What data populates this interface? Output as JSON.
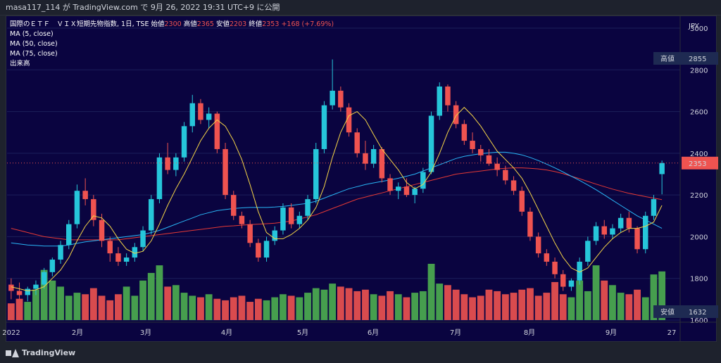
{
  "header": {
    "publisher": "masa117_114 が TradingView.com で 9月 26, 2022 19:31 UTC+9 に公開"
  },
  "footer": {
    "brand": "TradingView"
  },
  "legend": {
    "symbol": "国際のＥＴＦ　ＶＩＸ短期先物指数, 1日, TSE",
    "open_label": "始値",
    "open": "2300",
    "high_label": "高値",
    "high": "2365",
    "low_label": "安値",
    "low": "2203",
    "close_label": "終値",
    "close": "2353",
    "change": "+168 (+7.69%)",
    "ma5": "MA (5, close)",
    "ma50": "MA (50, close)",
    "ma75": "MA (75, close)",
    "volume": "出来高"
  },
  "colors": {
    "up": "#26c6da",
    "down": "#ef5350",
    "vol_up": "#4caf50",
    "vol_down": "#ef5350",
    "ma5": "#f5d547",
    "ma50": "#29b6f6",
    "ma75": "#e53935",
    "background": "#0a0440"
  },
  "chart_data": {
    "type": "candlestick",
    "currency": "JPY",
    "y_axis": {
      "ticks": [
        1600,
        1800,
        2000,
        2200,
        2400,
        2600,
        2800,
        3000
      ],
      "range": [
        1600,
        3000
      ]
    },
    "x_axis": {
      "ticks": [
        "2022",
        "2月",
        "3月",
        "4月",
        "5月",
        "6月",
        "7月",
        "8月",
        "9月",
        "27"
      ]
    },
    "markers": [
      {
        "label": "高値",
        "value": 2855
      },
      {
        "label": "安値",
        "value": 1632
      }
    ],
    "last_price": 2353,
    "candles": [
      [
        1770,
        1800,
        1700,
        1740
      ],
      [
        1740,
        1780,
        1700,
        1720
      ],
      [
        1720,
        1760,
        1690,
        1750
      ],
      [
        1750,
        1790,
        1720,
        1770
      ],
      [
        1770,
        1850,
        1750,
        1830
      ],
      [
        1830,
        1900,
        1810,
        1890
      ],
      [
        1890,
        1980,
        1870,
        1960
      ],
      [
        1960,
        2080,
        1940,
        2060
      ],
      [
        2060,
        2250,
        2040,
        2220
      ],
      [
        2220,
        2280,
        2150,
        2180
      ],
      [
        2180,
        2200,
        2050,
        2080
      ],
      [
        2080,
        2110,
        1950,
        1980
      ],
      [
        1980,
        2000,
        1880,
        1920
      ],
      [
        1920,
        1950,
        1860,
        1880
      ],
      [
        1880,
        1920,
        1860,
        1900
      ],
      [
        1900,
        1970,
        1880,
        1950
      ],
      [
        1950,
        2050,
        1930,
        2030
      ],
      [
        2030,
        2200,
        2010,
        2180
      ],
      [
        2180,
        2400,
        2160,
        2380
      ],
      [
        2380,
        2450,
        2300,
        2320
      ],
      [
        2320,
        2400,
        2290,
        2380
      ],
      [
        2380,
        2550,
        2360,
        2530
      ],
      [
        2530,
        2680,
        2500,
        2640
      ],
      [
        2640,
        2660,
        2540,
        2560
      ],
      [
        2560,
        2620,
        2520,
        2590
      ],
      [
        2590,
        2600,
        2400,
        2420
      ],
      [
        2420,
        2450,
        2180,
        2200
      ],
      [
        2200,
        2220,
        2080,
        2100
      ],
      [
        2100,
        2120,
        2040,
        2060
      ],
      [
        2060,
        2080,
        1950,
        1970
      ],
      [
        1970,
        1990,
        1880,
        1900
      ],
      [
        1900,
        2000,
        1880,
        1980
      ],
      [
        1980,
        2050,
        1960,
        2030
      ],
      [
        2030,
        2160,
        2010,
        2140
      ],
      [
        2140,
        2160,
        2040,
        2060
      ],
      [
        2060,
        2120,
        2040,
        2100
      ],
      [
        2100,
        2200,
        2080,
        2180
      ],
      [
        2180,
        2450,
        2160,
        2420
      ],
      [
        2420,
        2650,
        2400,
        2630
      ],
      [
        2630,
        2850,
        2610,
        2700
      ],
      [
        2700,
        2720,
        2600,
        2620
      ],
      [
        2620,
        2640,
        2480,
        2500
      ],
      [
        2500,
        2520,
        2380,
        2400
      ],
      [
        2400,
        2460,
        2320,
        2350
      ],
      [
        2350,
        2440,
        2330,
        2420
      ],
      [
        2420,
        2430,
        2260,
        2280
      ],
      [
        2280,
        2300,
        2200,
        2220
      ],
      [
        2220,
        2260,
        2180,
        2240
      ],
      [
        2240,
        2280,
        2190,
        2200
      ],
      [
        2200,
        2240,
        2160,
        2230
      ],
      [
        2230,
        2330,
        2210,
        2310
      ],
      [
        2310,
        2600,
        2300,
        2580
      ],
      [
        2580,
        2740,
        2560,
        2720
      ],
      [
        2720,
        2730,
        2600,
        2630
      ],
      [
        2630,
        2650,
        2520,
        2540
      ],
      [
        2540,
        2560,
        2440,
        2460
      ],
      [
        2460,
        2500,
        2400,
        2420
      ],
      [
        2420,
        2440,
        2360,
        2390
      ],
      [
        2390,
        2420,
        2340,
        2350
      ],
      [
        2350,
        2380,
        2290,
        2320
      ],
      [
        2320,
        2340,
        2250,
        2270
      ],
      [
        2270,
        2290,
        2200,
        2220
      ],
      [
        2220,
        2240,
        2100,
        2120
      ],
      [
        2120,
        2140,
        1980,
        2000
      ],
      [
        2000,
        2020,
        1900,
        1920
      ],
      [
        1920,
        1940,
        1860,
        1880
      ],
      [
        1880,
        1900,
        1800,
        1820
      ],
      [
        1820,
        1840,
        1740,
        1760
      ],
      [
        1760,
        1800,
        1740,
        1790
      ],
      [
        1790,
        1900,
        1770,
        1880
      ],
      [
        1880,
        2000,
        1860,
        1980
      ],
      [
        1980,
        2070,
        1960,
        2050
      ],
      [
        2050,
        2080,
        1990,
        2010
      ],
      [
        2010,
        2060,
        1990,
        2040
      ],
      [
        2040,
        2110,
        2020,
        2090
      ],
      [
        2090,
        2120,
        2020,
        2040
      ],
      [
        2040,
        2050,
        1920,
        1940
      ],
      [
        1940,
        2120,
        1920,
        2100
      ],
      [
        2100,
        2200,
        2080,
        2180
      ],
      [
        2300,
        2365,
        2203,
        2353
      ]
    ],
    "volume": [
      110,
      140,
      120,
      200,
      330,
      260,
      220,
      160,
      180,
      170,
      210,
      160,
      130,
      170,
      220,
      160,
      260,
      310,
      360,
      220,
      230,
      180,
      160,
      150,
      170,
      140,
      130,
      150,
      160,
      120,
      140,
      130,
      150,
      170,
      160,
      150,
      180,
      210,
      200,
      240,
      220,
      210,
      190,
      200,
      170,
      160,
      190,
      170,
      150,
      180,
      190,
      370,
      240,
      230,
      200,
      170,
      150,
      160,
      200,
      190,
      170,
      180,
      200,
      210,
      160,
      180,
      250,
      170,
      150,
      260,
      190,
      360,
      260,
      230,
      180,
      170,
      200,
      150,
      300,
      320
    ],
    "ma5": [
      1760,
      1750,
      1740,
      1745,
      1760,
      1800,
      1840,
      1900,
      1980,
      2050,
      2100,
      2090,
      2050,
      1990,
      1940,
      1920,
      1930,
      1980,
      2060,
      2150,
      2230,
      2300,
      2380,
      2460,
      2520,
      2560,
      2530,
      2460,
      2370,
      2250,
      2120,
      2020,
      1990,
      1990,
      2010,
      2040,
      2080,
      2140,
      2240,
      2380,
      2500,
      2580,
      2600,
      2560,
      2490,
      2420,
      2370,
      2320,
      2260,
      2230,
      2250,
      2310,
      2400,
      2500,
      2580,
      2620,
      2580,
      2530,
      2470,
      2410,
      2370,
      2330,
      2280,
      2210,
      2130,
      2050,
      1970,
      1900,
      1850,
      1830,
      1850,
      1900,
      1950,
      1990,
      2020,
      2040,
      2040,
      2050,
      2070,
      2150
    ],
    "ma50": [
      1970,
      1965,
      1960,
      1958,
      1955,
      1955,
      1955,
      1960,
      1968,
      1975,
      1980,
      1985,
      1990,
      1995,
      2000,
      2005,
      2010,
      2020,
      2030,
      2045,
      2060,
      2075,
      2090,
      2105,
      2115,
      2125,
      2130,
      2135,
      2138,
      2140,
      2140,
      2140,
      2142,
      2145,
      2150,
      2155,
      2160,
      2170,
      2185,
      2200,
      2215,
      2230,
      2240,
      2250,
      2258,
      2265,
      2272,
      2280,
      2290,
      2300,
      2315,
      2330,
      2345,
      2360,
      2375,
      2385,
      2392,
      2398,
      2402,
      2405,
      2405,
      2400,
      2392,
      2380,
      2365,
      2348,
      2330,
      2310,
      2290,
      2270,
      2248,
      2225,
      2200,
      2175,
      2150,
      2125,
      2100,
      2080,
      2060,
      2040
    ],
    "ma75": [
      2040,
      2030,
      2020,
      2010,
      2000,
      1995,
      1990,
      1985,
      1985,
      1985,
      1985,
      1985,
      1985,
      1985,
      1990,
      1995,
      2000,
      2005,
      2010,
      2015,
      2020,
      2025,
      2030,
      2035,
      2040,
      2045,
      2050,
      2052,
      2055,
      2058,
      2060,
      2062,
      2065,
      2070,
      2075,
      2085,
      2095,
      2105,
      2120,
      2135,
      2150,
      2165,
      2180,
      2190,
      2200,
      2210,
      2220,
      2230,
      2240,
      2250,
      2260,
      2270,
      2280,
      2290,
      2300,
      2305,
      2310,
      2315,
      2320,
      2325,
      2328,
      2330,
      2330,
      2328,
      2325,
      2320,
      2312,
      2302,
      2290,
      2278,
      2265,
      2252,
      2240,
      2228,
      2218,
      2208,
      2200,
      2192,
      2185,
      2178
    ]
  }
}
